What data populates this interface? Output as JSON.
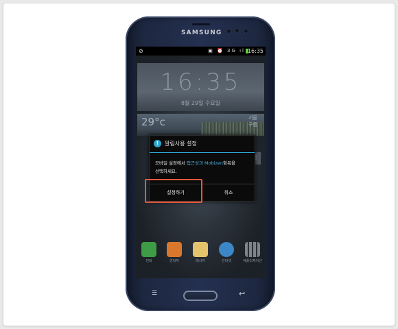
{
  "phone": {
    "brand": "SAMSUNG"
  },
  "statusbar": {
    "left_icon": "⊘",
    "icons": "▣ ⏰ 3G ıl",
    "time": "16:35"
  },
  "lockscreen": {
    "clock": "16:35",
    "date": "8월 29일 수요일",
    "temperature": "29°c",
    "location": "서울\n구름"
  },
  "dialog": {
    "title": "알림사용 설정",
    "message_part1": "모바일 설정에서 ",
    "message_highlight": "접근성과 Mobizen",
    "message_part2": "항목을",
    "message_line2": "선택하세요.",
    "confirm_label": "설정하기",
    "cancel_label": "취소",
    "accent_color": "#2da4cf"
  },
  "dock": {
    "apps": [
      {
        "name": "phone",
        "label": "전화",
        "color": "#3e9b46"
      },
      {
        "name": "contacts",
        "label": "연락처",
        "color": "#d9782d"
      },
      {
        "name": "messages",
        "label": "메시지",
        "color": "#e3c36b"
      },
      {
        "name": "internet",
        "label": "인터넷",
        "color": "#3c87c7"
      },
      {
        "name": "apps",
        "label": "애플리케이션",
        "color": "#7d848c"
      }
    ]
  },
  "annotation": {
    "highlight_color": "#e4583c"
  }
}
